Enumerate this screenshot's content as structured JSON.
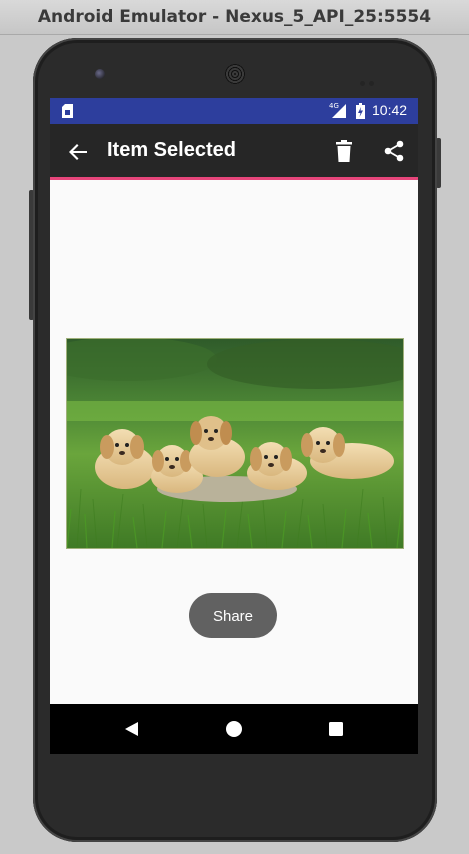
{
  "emulator": {
    "window_title": "Android Emulator - Nexus_5_API_25:5554"
  },
  "status_bar": {
    "network": "4G",
    "time": "10:42"
  },
  "toolbar": {
    "title": "Item Selected",
    "back_icon": "arrow-back-icon",
    "delete_icon": "trash-icon",
    "share_icon": "share-icon"
  },
  "content": {
    "image_subject": "puppies",
    "share_button_label": "Share"
  },
  "navigation": {
    "back_icon": "triangle-back-icon",
    "home_icon": "circle-home-icon",
    "recents_icon": "square-recents-icon"
  },
  "colors": {
    "status_bar": "#2d3e9d",
    "toolbar": "#262626",
    "accent": "#e6457a",
    "button": "#616161"
  }
}
